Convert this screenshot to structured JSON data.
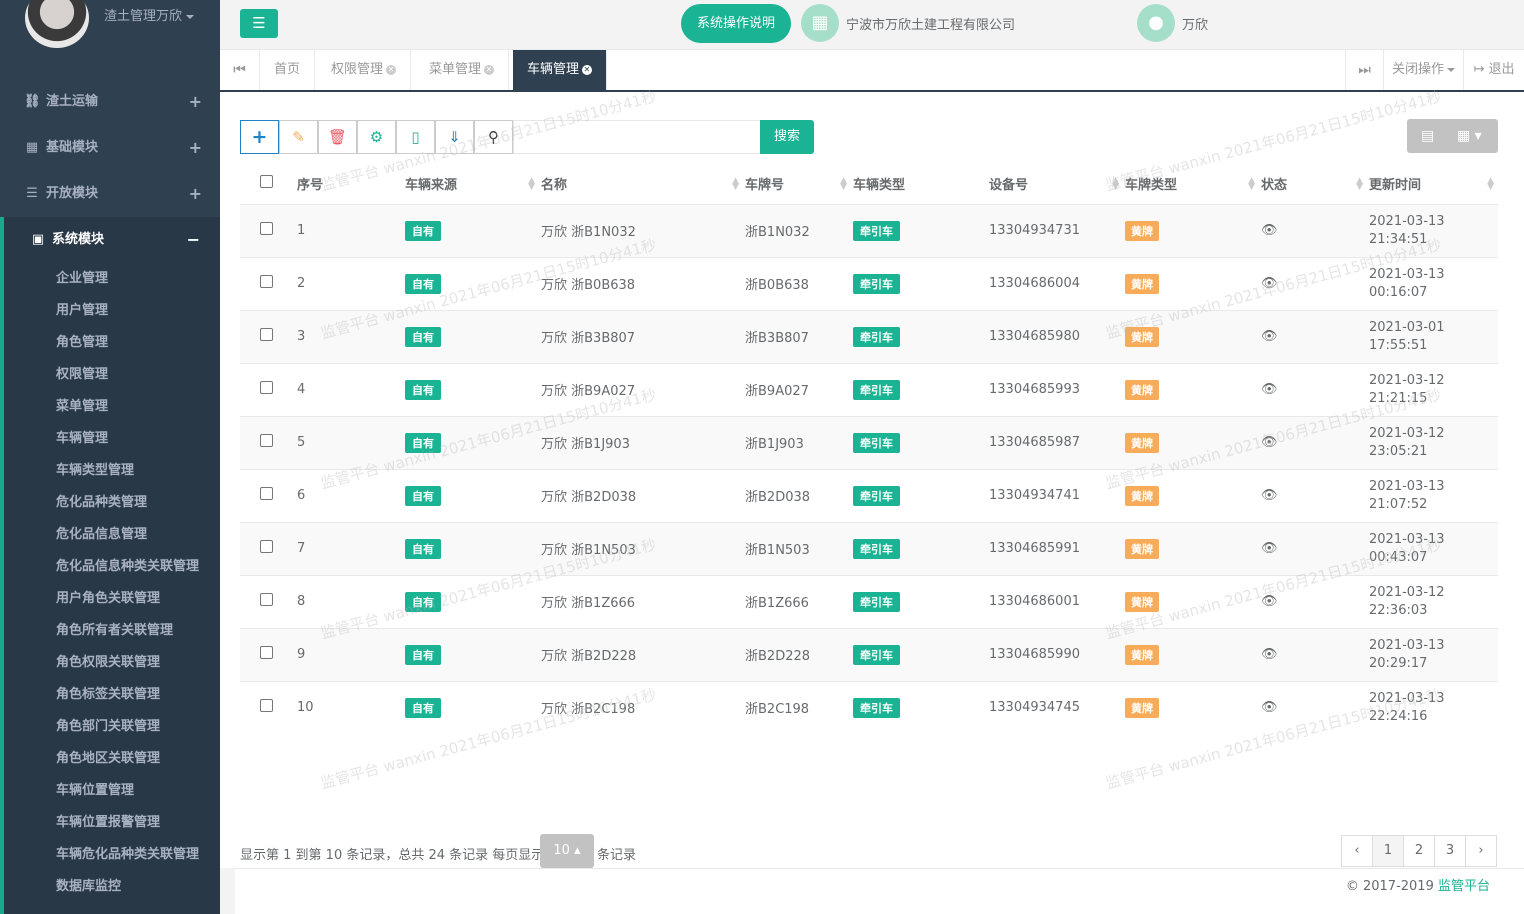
{
  "sidebar": {
    "user_role": "渣土管理万欣",
    "nav": [
      {
        "label": "渣土运输",
        "icon": "car-icon"
      },
      {
        "label": "基础模块",
        "icon": "grid-icon"
      },
      {
        "label": "开放模块",
        "icon": "list-icon"
      },
      {
        "label": "系统模块",
        "icon": "box-icon"
      }
    ],
    "expand_symbol": "+",
    "collapse_symbol": "−",
    "sub_items": [
      "企业管理",
      "用户管理",
      "角色管理",
      "权限管理",
      "菜单管理",
      "车辆管理",
      "车辆类型管理",
      "危化品种类管理",
      "危化品信息管理",
      "危化品信息种类关联管理",
      "用户角色关联管理",
      "角色所有者关联管理",
      "角色权限关联管理",
      "角色标签关联管理",
      "角色部门关联管理",
      "角色地区关联管理",
      "车辆位置管理",
      "车辆位置报警管理",
      "车辆危化品种类关联管理",
      "数据库监控"
    ]
  },
  "header": {
    "help_button": "系统操作说明",
    "company": "宁波市万欣土建工程有限公司",
    "user": "万欣"
  },
  "tabs": {
    "items": [
      "首页",
      "权限管理",
      "菜单管理",
      "车辆管理"
    ],
    "active": "车辆管理",
    "close_ops": "关闭操作",
    "logout": "退出"
  },
  "toolbar": {
    "search_placeholder": "",
    "search_label": "搜索"
  },
  "table": {
    "headers": [
      "序号",
      "车辆来源",
      "名称",
      "车牌号",
      "车辆类型",
      "设备号",
      "车牌类型",
      "状态",
      "更新时间"
    ],
    "rows": [
      {
        "no": "1",
        "source": "自有",
        "name": "万欣 浙B1N032",
        "plate": "浙B1N032",
        "type": "牵引车",
        "device": "13304934731",
        "plate_type": "黄牌",
        "date": "2021-03-13",
        "time": "21:34:51"
      },
      {
        "no": "2",
        "source": "自有",
        "name": "万欣 浙B0B638",
        "plate": "浙B0B638",
        "type": "牵引车",
        "device": "13304686004",
        "plate_type": "黄牌",
        "date": "2021-03-13",
        "time": "00:16:07"
      },
      {
        "no": "3",
        "source": "自有",
        "name": "万欣 浙B3B807",
        "plate": "浙B3B807",
        "type": "牵引车",
        "device": "13304685980",
        "plate_type": "黄牌",
        "date": "2021-03-01",
        "time": "17:55:51"
      },
      {
        "no": "4",
        "source": "自有",
        "name": "万欣 浙B9A027",
        "plate": "浙B9A027",
        "type": "牵引车",
        "device": "13304685993",
        "plate_type": "黄牌",
        "date": "2021-03-12",
        "time": "21:21:15"
      },
      {
        "no": "5",
        "source": "自有",
        "name": "万欣 浙B1J903",
        "plate": "浙B1J903",
        "type": "牵引车",
        "device": "13304685987",
        "plate_type": "黄牌",
        "date": "2021-03-12",
        "time": "23:05:21"
      },
      {
        "no": "6",
        "source": "自有",
        "name": "万欣 浙B2D038",
        "plate": "浙B2D038",
        "type": "牵引车",
        "device": "13304934741",
        "plate_type": "黄牌",
        "date": "2021-03-13",
        "time": "21:07:52"
      },
      {
        "no": "7",
        "source": "自有",
        "name": "万欣 浙B1N503",
        "plate": "浙B1N503",
        "type": "牵引车",
        "device": "13304685991",
        "plate_type": "黄牌",
        "date": "2021-03-13",
        "time": "00:43:07"
      },
      {
        "no": "8",
        "source": "自有",
        "name": "万欣 浙B1Z666",
        "plate": "浙B1Z666",
        "type": "牵引车",
        "device": "13304686001",
        "plate_type": "黄牌",
        "date": "2021-03-12",
        "time": "22:36:03"
      },
      {
        "no": "9",
        "source": "自有",
        "name": "万欣 浙B2D228",
        "plate": "浙B2D228",
        "type": "牵引车",
        "device": "13304685990",
        "plate_type": "黄牌",
        "date": "2021-03-13",
        "time": "20:29:17"
      },
      {
        "no": "10",
        "source": "自有",
        "name": "万欣 浙B2C198",
        "plate": "浙B2C198",
        "type": "牵引车",
        "device": "13304934745",
        "plate_type": "黄牌",
        "date": "2021-03-13",
        "time": "22:24:16"
      }
    ]
  },
  "pagination": {
    "info": "显示第 1 到第 10 条记录，总共 24 条记录 每页显示",
    "page_size": "10",
    "page_size_suffix": "条记录",
    "pages": [
      "‹",
      "1",
      "2",
      "3",
      "›"
    ],
    "current": "1"
  },
  "footer": {
    "copyright": "© 2017-2019 ",
    "brand": "监管平台"
  },
  "watermark": "监管平台 wanxin 2021年06月21日15时10分41秒",
  "colors": {
    "accent": "#1ab394",
    "sidebar": "#2f4050",
    "warning": "#f8ac59"
  }
}
